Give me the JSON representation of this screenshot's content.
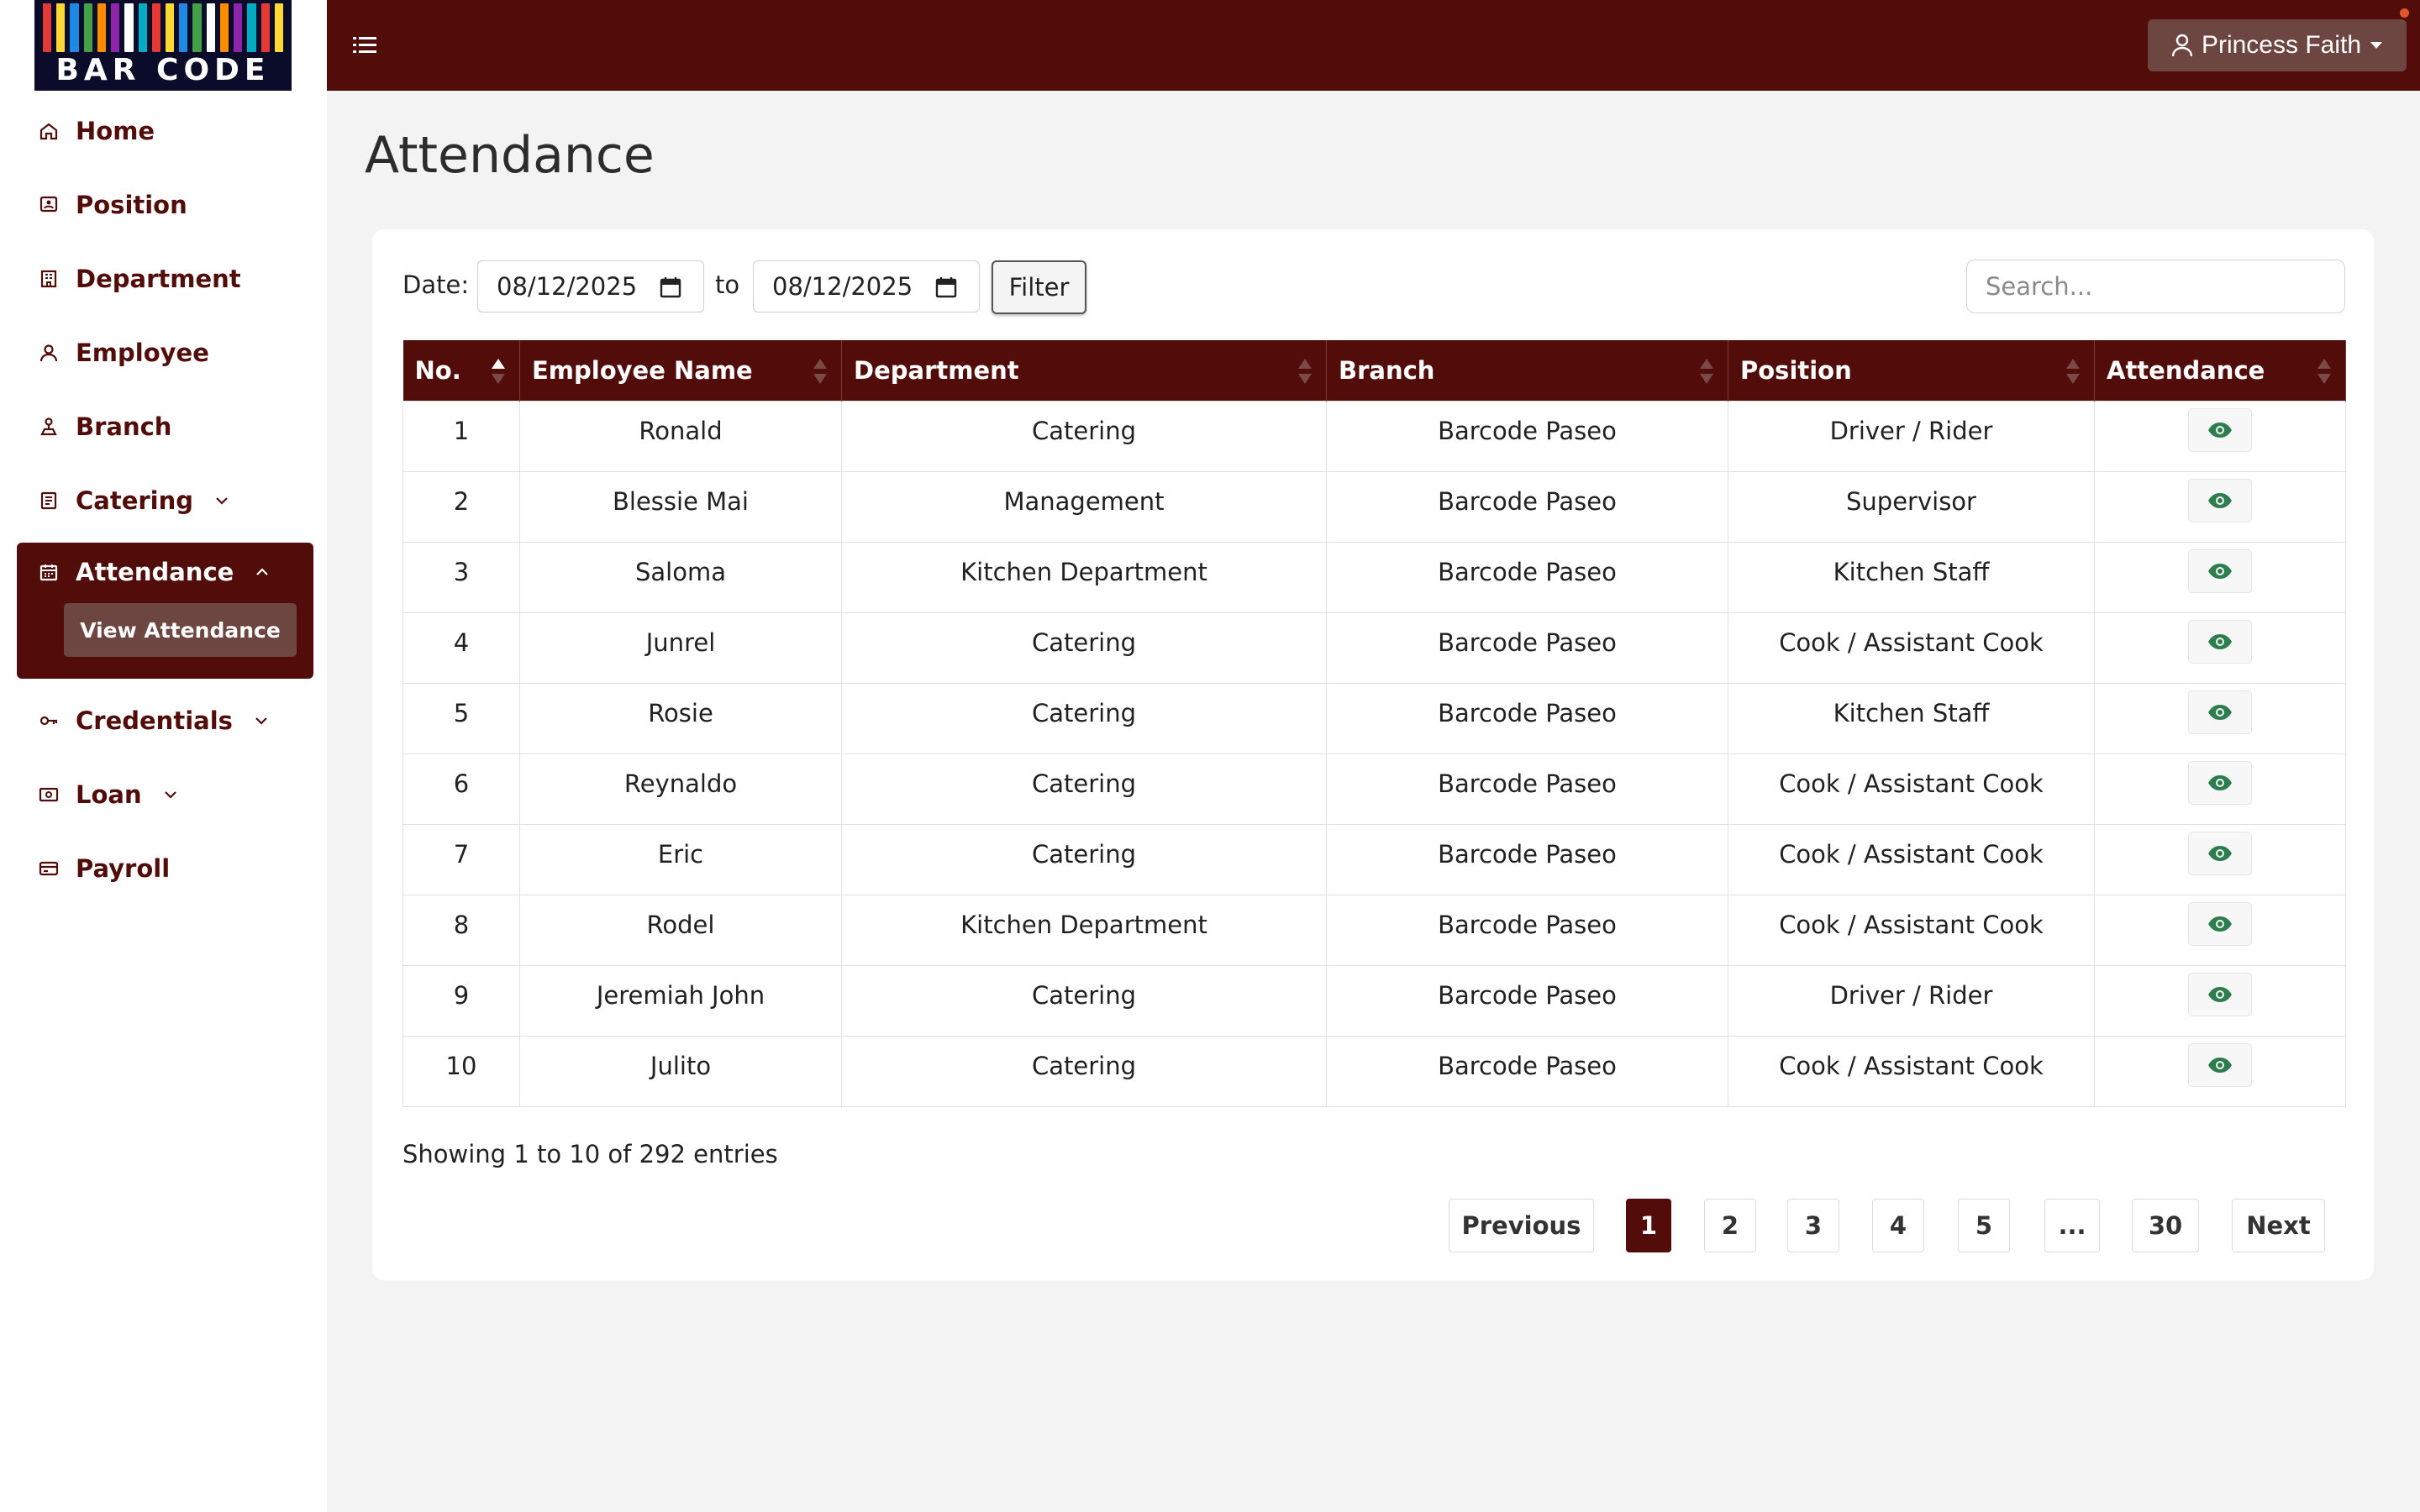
{
  "logo": {
    "text": "BAR CODE",
    "bar_colors": [
      "#e53935",
      "#fdd835",
      "#1e88e5",
      "#43a047",
      "#fb8c00",
      "#8e24aa",
      "#ffffff",
      "#00acc1",
      "#e53935",
      "#fdd835",
      "#1e88e5",
      "#43a047",
      "#ffffff",
      "#fb8c00",
      "#8e24aa",
      "#00acc1",
      "#e53935",
      "#fdd835"
    ]
  },
  "colors": {
    "brand": "#520d0a",
    "brand_light": "#6d4541",
    "eye": "#2e7d4f"
  },
  "header": {
    "user_name": "Princess Faith"
  },
  "sidebar": {
    "items": [
      {
        "label": "Home",
        "icon": "home-icon"
      },
      {
        "label": "Position",
        "icon": "position-icon"
      },
      {
        "label": "Department",
        "icon": "department-icon"
      },
      {
        "label": "Employee",
        "icon": "user-icon"
      },
      {
        "label": "Branch",
        "icon": "branch-icon"
      },
      {
        "label": "Catering",
        "icon": "catering-icon"
      },
      {
        "label": "Attendance",
        "icon": "calendar-icon"
      },
      {
        "label": "Credentials",
        "icon": "key-icon"
      },
      {
        "label": "Loan",
        "icon": "loan-icon"
      },
      {
        "label": "Payroll",
        "icon": "payroll-icon"
      }
    ],
    "attendance_sub": "View Attendance"
  },
  "page": {
    "title": "Attendance"
  },
  "filters": {
    "date_label": "Date:",
    "date_from": "08/12/2025",
    "to_label": "to",
    "date_to": "08/12/2025",
    "filter_button": "Filter",
    "search_placeholder": "Search..."
  },
  "table": {
    "columns": [
      "No.",
      "Employee Name",
      "Department",
      "Branch",
      "Position",
      "Attendance"
    ],
    "rows": [
      [
        "1",
        "Ronald",
        "Catering",
        "Barcode Paseo",
        "Driver / Rider"
      ],
      [
        "2",
        "Blessie Mai",
        "Management",
        "Barcode Paseo",
        "Supervisor"
      ],
      [
        "3",
        "Saloma",
        "Kitchen Department",
        "Barcode Paseo",
        "Kitchen Staff"
      ],
      [
        "4",
        "Junrel",
        "Catering",
        "Barcode Paseo",
        "Cook / Assistant Cook"
      ],
      [
        "5",
        "Rosie",
        "Catering",
        "Barcode Paseo",
        "Kitchen Staff"
      ],
      [
        "6",
        "Reynaldo",
        "Catering",
        "Barcode Paseo",
        "Cook / Assistant Cook"
      ],
      [
        "7",
        "Eric",
        "Catering",
        "Barcode Paseo",
        "Cook / Assistant Cook"
      ],
      [
        "8",
        "Rodel",
        "Kitchen Department",
        "Barcode Paseo",
        "Cook / Assistant Cook"
      ],
      [
        "9",
        "Jeremiah John",
        "Catering",
        "Barcode Paseo",
        "Driver / Rider"
      ],
      [
        "10",
        "Julito",
        "Catering",
        "Barcode Paseo",
        "Cook / Assistant Cook"
      ]
    ]
  },
  "footer": {
    "showing": "Showing 1 to 10 of 292 entries",
    "pagination": [
      "Previous",
      "1",
      "2",
      "3",
      "4",
      "5",
      "...",
      "30",
      "Next"
    ],
    "active_page": "1"
  }
}
